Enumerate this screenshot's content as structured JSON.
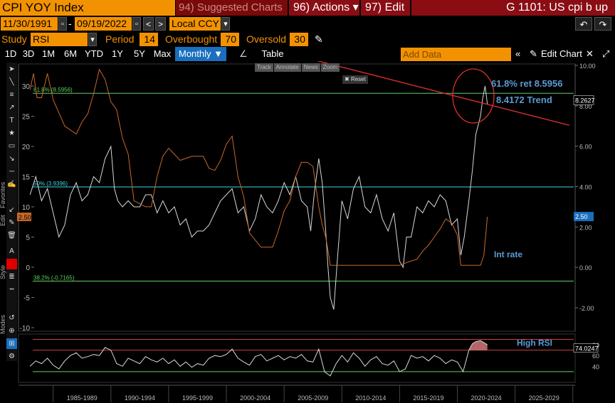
{
  "header": {
    "ticker": "CPI YOY Index",
    "suggested": "94) Suggested Charts",
    "actions": "96) Actions",
    "edit": "97) Edit",
    "title": "G 1101: US cpi b up"
  },
  "controls": {
    "start_date": "11/30/1991",
    "end_date": "09/19/2022",
    "currency": "Local CCY",
    "study_label": "Study",
    "study_value": "RSI",
    "period_label": "Period",
    "period_value": "14",
    "overbought_label": "Overbought",
    "overbought_value": "70",
    "oversold_label": "Oversold",
    "oversold_value": "30",
    "add_data_placeholder": "Add Data",
    "edit_chart": "Edit Chart"
  },
  "tabs": [
    "1D",
    "3D",
    "1M",
    "6M",
    "YTD",
    "1Y",
    "5Y",
    "Max",
    "Monthly",
    "Table"
  ],
  "active_tab": "Monthly",
  "toolbar_mini": [
    "Track",
    "Annotate",
    "News",
    "Zoom"
  ],
  "reset_label": "Reset",
  "sidebar_labels": [
    "Favorites",
    "Edit",
    "Style",
    "Modes"
  ],
  "chart_data": [
    {
      "type": "line",
      "title": "",
      "xlabel": "",
      "ylabel": "",
      "x_tick_labels": [
        "1985-1989",
        "1990-1994",
        "1995-1999",
        "2000-2004",
        "2005-2009",
        "2010-2014",
        "2015-2019",
        "2020-2024",
        "2025-2029"
      ],
      "y_left_ticks": [
        30,
        25,
        20,
        15,
        10,
        5,
        0,
        -5,
        -10
      ],
      "y_right_ticks": [
        10.0,
        8.0,
        6.0,
        4.0,
        2.0,
        0.0,
        -2.0
      ],
      "ylim_left": [
        -10,
        32
      ],
      "ylim_right": [
        -2.6,
        10.6
      ],
      "series": [
        {
          "name": "CPI YOY Index",
          "axis": "left",
          "color": "#d8d8d8",
          "x": [
            1983.0,
            1983.5,
            1984,
            1984.5,
            1985,
            1985.5,
            1986,
            1986.5,
            1987,
            1987.5,
            1988,
            1988.5,
            1989,
            1989.5,
            1990,
            1990.3,
            1990.6,
            1991,
            1991.5,
            1992,
            1992.5,
            1993,
            1993.5,
            1994,
            1994.5,
            1995,
            1995.5,
            1996,
            1996.5,
            1997,
            1997.5,
            1998,
            1998.5,
            1999,
            1999.5,
            2000,
            2000.5,
            2001,
            2001.5,
            2002,
            2002.5,
            2003,
            2003.5,
            2004,
            2004.5,
            2005,
            2005.5,
            2006,
            2006.5,
            2007,
            2007.3,
            2007.6,
            2008,
            2008.3,
            2008.6,
            2008.8,
            2009,
            2009.3,
            2009.6,
            2010,
            2010.5,
            2011,
            2011.5,
            2012,
            2012.5,
            2013,
            2013.5,
            2014,
            2014.5,
            2015,
            2015.3,
            2015.6,
            2016,
            2016.5,
            2017,
            2017.5,
            2018,
            2018.5,
            2019,
            2019.5,
            2020,
            2020.3,
            2020.6,
            2021,
            2021.3,
            2021.6,
            2022,
            2022.2,
            2022.4,
            2022.6
          ],
          "values": [
            12,
            15,
            11,
            13,
            9,
            5,
            7,
            12,
            14,
            11,
            12,
            15,
            14,
            18,
            20,
            13,
            11,
            10,
            11,
            10,
            10,
            12,
            12,
            9,
            11,
            9,
            10,
            7,
            8,
            5,
            6,
            6,
            7,
            9,
            11,
            12,
            13,
            9,
            10,
            6,
            8,
            12,
            10,
            9,
            11,
            14,
            12,
            15,
            11,
            10,
            6,
            12,
            18,
            14,
            6,
            0,
            -5,
            -7,
            1,
            11,
            8,
            13,
            15,
            10,
            9,
            12,
            8,
            6,
            9,
            1,
            0,
            5,
            5,
            10,
            9,
            11,
            10,
            12,
            11,
            7,
            8,
            2,
            5,
            11,
            16,
            22,
            25,
            28,
            30,
            27
          ]
        },
        {
          "name": "Int rate",
          "axis": "right",
          "color": "#c8682a",
          "x": [
            1983.0,
            1983.3,
            1983.6,
            1984,
            1984.5,
            1985,
            1986,
            1987,
            1987.5,
            1988,
            1988.5,
            1989,
            1989.5,
            1990,
            1990.5,
            1991,
            1991.5,
            1992,
            1993,
            1993.5,
            1994,
            1994.5,
            1995,
            1996,
            1997,
            1998,
            1998.5,
            1999,
            1999.5,
            2000,
            2000.5,
            2001,
            2001.5,
            2002,
            2003,
            2003.5,
            2004,
            2004.5,
            2005,
            2005.5,
            2006,
            2006.5,
            2007,
            2007.5,
            2008,
            2008.3,
            2008.6,
            2008.9,
            2009,
            2010,
            2011,
            2012,
            2013,
            2014,
            2015,
            2015.9,
            2016.5,
            2017,
            2017.5,
            2018,
            2018.5,
            2019,
            2019.5,
            2020,
            2020.3,
            2021,
            2022,
            2022.3,
            2022.6
          ],
          "values": [
            8.8,
            9.6,
            8.4,
            8.4,
            9.6,
            8.3,
            7.0,
            6.6,
            7.2,
            7.6,
            8.6,
            9.8,
            9.3,
            8.2,
            7.8,
            6.4,
            5.6,
            3.3,
            3.0,
            3.0,
            4.5,
            5.5,
            5.9,
            5.3,
            5.5,
            5.5,
            4.9,
            4.8,
            5.3,
            6.1,
            6.5,
            4.5,
            3.5,
            1.7,
            1.0,
            1.0,
            1.0,
            1.8,
            2.8,
            3.3,
            4.5,
            5.2,
            5.2,
            5.0,
            3.0,
            2.1,
            1.5,
            0.5,
            0.1,
            0.1,
            0.1,
            0.1,
            0.1,
            0.1,
            0.1,
            0.3,
            0.4,
            0.8,
            1.1,
            1.5,
            1.9,
            2.4,
            2.2,
            1.6,
            0.1,
            0.1,
            0.1,
            0.6,
            2.5
          ]
        },
        {
          "name": "Trend",
          "axis": "left",
          "color": "#e03030",
          "x": [
            2007.2,
            2029.7
          ],
          "values": [
            34.5,
            23.5
          ]
        }
      ],
      "horizontal_lines": [
        {
          "label": "61.8% (8.5956)",
          "value": 28.8,
          "color": "#5fd35f"
        },
        {
          "label": "50% (3.9396)",
          "value": 13.3,
          "color": "#3fd7e0"
        },
        {
          "label": "38.2% (-0.7165)",
          "value": -2.3,
          "color": "#5fd35f"
        }
      ],
      "annotations": [
        {
          "text": "61.8% ret 8.5956",
          "color": "#5b9bd5"
        },
        {
          "text": "8.4172 Trend",
          "color": "#5b9bd5"
        },
        {
          "text": "Int rate",
          "color": "#5b9bd5"
        }
      ],
      "right_badges": [
        {
          "text": "8.2627",
          "axis": "right",
          "value": 8.26,
          "color": "#000"
        },
        {
          "text": "2.50",
          "axis": "right",
          "value": 2.5,
          "color": "#1a6fbf"
        }
      ],
      "left_badge": {
        "text": "2.50",
        "value": 2.5
      },
      "grid": true
    },
    {
      "type": "line",
      "title": "",
      "y_ticks": [
        80,
        60,
        40
      ],
      "ylim": [
        10,
        100
      ],
      "overbought": 70,
      "oversold": 30,
      "upper_band": 90,
      "series": [
        {
          "name": "RSI",
          "color": "#d8d8d8",
          "x": [
            1983,
            1983.5,
            1984,
            1984.5,
            1985,
            1985.5,
            1986,
            1986.5,
            1987,
            1987.5,
            1988,
            1988.5,
            1989,
            1989.5,
            1990,
            1990.5,
            1991,
            1991.5,
            1992,
            1992.5,
            1993,
            1993.5,
            1994,
            1994.5,
            1995,
            1995.5,
            1996,
            1996.5,
            1997,
            1997.5,
            1998,
            1998.5,
            1999,
            1999.5,
            2000,
            2000.5,
            2001,
            2001.5,
            2002,
            2002.5,
            2003,
            2003.5,
            2004,
            2004.5,
            2005,
            2005.5,
            2006,
            2006.5,
            2007,
            2007.5,
            2008,
            2008.5,
            2009,
            2009.5,
            2010,
            2010.5,
            2011,
            2011.5,
            2012,
            2012.5,
            2013,
            2013.5,
            2014,
            2014.5,
            2015,
            2015.5,
            2016,
            2016.5,
            2017,
            2017.5,
            2018,
            2018.5,
            2019,
            2019.5,
            2020,
            2020.5,
            2021,
            2021.3,
            2021.6,
            2022,
            2022.3,
            2022.6
          ],
          "values": [
            40,
            50,
            45,
            55,
            42,
            35,
            50,
            60,
            65,
            55,
            58,
            62,
            60,
            75,
            70,
            45,
            40,
            55,
            50,
            45,
            58,
            52,
            48,
            55,
            45,
            52,
            40,
            48,
            38,
            45,
            42,
            55,
            60,
            58,
            62,
            72,
            55,
            48,
            42,
            58,
            62,
            50,
            55,
            60,
            52,
            58,
            55,
            62,
            50,
            48,
            72,
            30,
            22,
            45,
            60,
            48,
            65,
            55,
            40,
            52,
            58,
            45,
            42,
            50,
            30,
            35,
            60,
            55,
            58,
            50,
            60,
            55,
            45,
            52,
            48,
            30,
            70,
            82,
            86,
            88,
            84,
            80
          ]
        }
      ],
      "annotations": [
        {
          "text": "High RSI",
          "color": "#5b9bd5"
        }
      ],
      "right_badge": {
        "text": "74.0247",
        "value": 74.02
      }
    }
  ]
}
